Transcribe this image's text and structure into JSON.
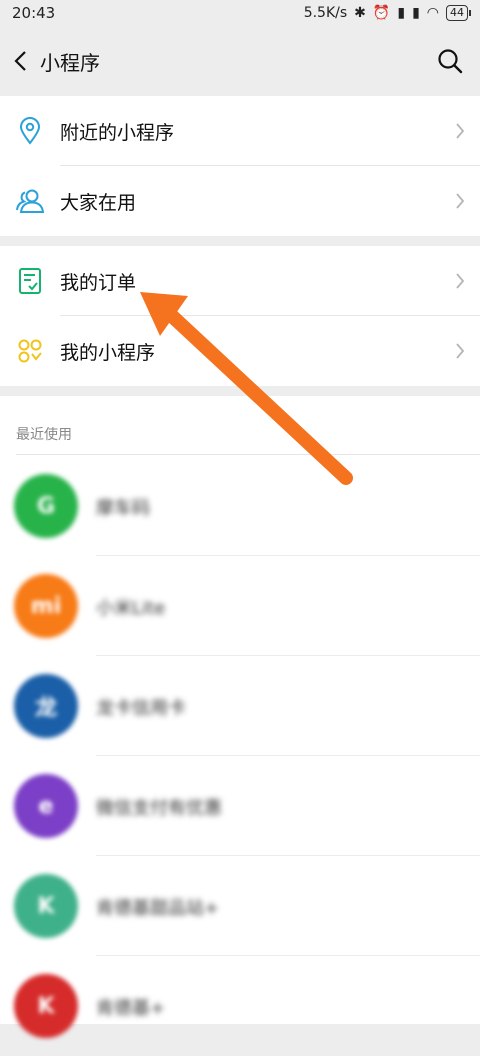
{
  "status": {
    "time": "20:43",
    "net_speed": "5.5K/s",
    "battery": "44"
  },
  "nav": {
    "title": "小程序",
    "back_icon": "chevron-left-icon",
    "search_icon": "search-icon"
  },
  "menu_group_1": [
    {
      "label": "附近的小程序",
      "icon": "location-pin-icon",
      "color": "#2aa2d9"
    },
    {
      "label": "大家在用",
      "icon": "people-icon",
      "color": "#2aa2d9"
    }
  ],
  "menu_group_2": [
    {
      "label": "我的订单",
      "icon": "order-list-icon",
      "color": "#14b36e"
    },
    {
      "label": "我的小程序",
      "icon": "apps-grid-icon",
      "color": "#f0c419"
    }
  ],
  "recent": {
    "title": "最近使用",
    "apps": [
      {
        "name": "摩车码",
        "icon_color": "#27b34a",
        "glyph": "G"
      },
      {
        "name": "小米Lite",
        "icon_color": "#f77b17",
        "glyph": "mi"
      },
      {
        "name": "龙卡信用卡",
        "icon_color": "#1a5fa8",
        "glyph": "龙"
      },
      {
        "name": "微信支付有优惠",
        "icon_color": "#7c3fc7",
        "glyph": "e"
      },
      {
        "name": "肯德基甜品站+",
        "icon_color": "#3fb18a",
        "glyph": "K"
      },
      {
        "name": "肯德基+",
        "icon_color": "#d62b2b",
        "glyph": "K"
      }
    ]
  },
  "annotation": {
    "color": "#f5731f"
  }
}
